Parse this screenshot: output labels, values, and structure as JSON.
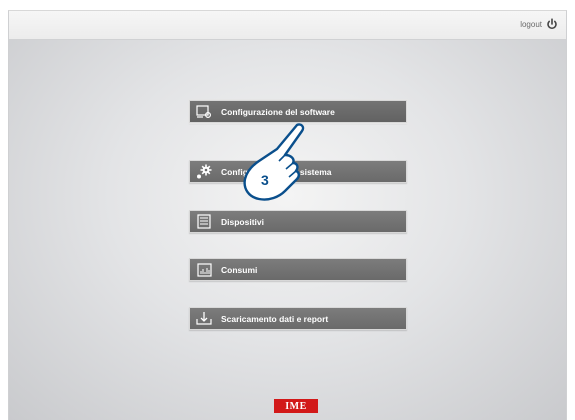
{
  "header": {
    "logout_label": "logout"
  },
  "menu": {
    "items": [
      {
        "label": "Configurazione del software",
        "icon": "monitor-gear-icon"
      },
      {
        "label": "Configurazione del sistema",
        "icon": "gears-icon"
      },
      {
        "label": "Dispositivi",
        "icon": "devices-stack-icon"
      },
      {
        "label": "Consumi",
        "icon": "bar-chart-icon"
      },
      {
        "label": "Scaricamento dati e report",
        "icon": "download-tray-icon"
      }
    ]
  },
  "overlay": {
    "step_number": "3"
  },
  "footer": {
    "brand": "IME"
  },
  "colors": {
    "button_bg": "#6f6f6f",
    "brand_red": "#d21919"
  }
}
